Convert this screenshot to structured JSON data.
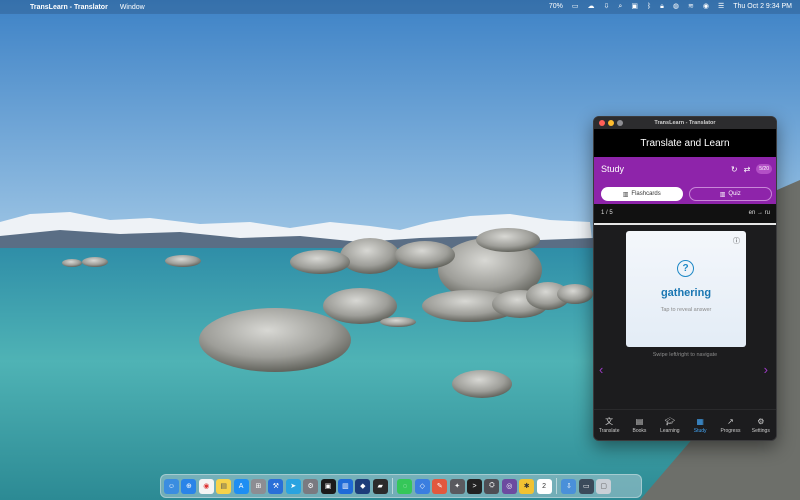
{
  "menubar": {
    "app_name": "TransLearn - Translator",
    "menus": [
      "Window"
    ],
    "battery": "70%",
    "date_time": "Thu Oct 2  9:34 PM",
    "status_icons": [
      "battery-icon",
      "input-icon",
      "cloud-icon",
      "download-icon",
      "screen-icon",
      "bluetooth-icon",
      "lock-icon",
      "chat-icon",
      "wifi-icon",
      "focus-icon",
      "search-icon",
      "control-center-icon"
    ]
  },
  "window": {
    "title": "TransLearn - Translator",
    "header": "Translate and Learn",
    "study": {
      "title": "Study",
      "count": "5/20",
      "tabs": [
        {
          "label": "Flashcards",
          "active": true
        },
        {
          "label": "Quiz",
          "active": false
        }
      ]
    },
    "progress": {
      "position": "1 / 5",
      "languages": "en → ru",
      "fraction": 1.0
    },
    "card": {
      "word": "gathering",
      "hint": "Tap to reveal answer"
    },
    "swipe_hint": "Swipe left/right to navigate",
    "nav": [
      {
        "label": "Translate",
        "icon": "translate-icon"
      },
      {
        "label": "Books",
        "icon": "book-icon"
      },
      {
        "label": "Learning",
        "icon": "graduation-cap-icon"
      },
      {
        "label": "Study",
        "icon": "study-icon",
        "active": true
      },
      {
        "label": "Progress",
        "icon": "trending-icon"
      },
      {
        "label": "Settings",
        "icon": "gear-icon"
      }
    ]
  },
  "dock": {
    "apps": [
      "finder",
      "safari",
      "chrome",
      "notes",
      "app-store",
      "launchpad",
      "xcode",
      "telegram",
      "system-settings",
      "pycharm",
      "trello",
      "vpn",
      "terminal-alt",
      "messages",
      "maps",
      "utility",
      "cleaner",
      "terminal",
      "dev-tool",
      "tor",
      "tips",
      "calendar",
      "downloads",
      "screen",
      "trash"
    ],
    "calendar_day": "2"
  },
  "colors": {
    "accent_purple": "#8e24aa",
    "card_word": "#1976b2",
    "active_nav": "#42a5f5"
  }
}
